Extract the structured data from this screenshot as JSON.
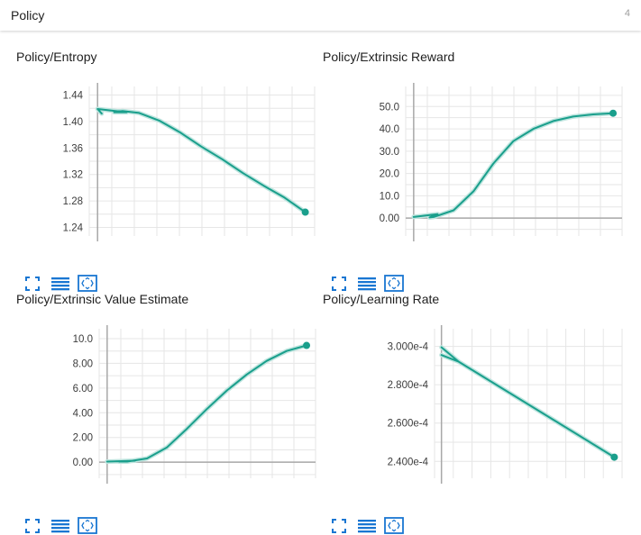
{
  "header": {
    "title": "Policy",
    "count": "4"
  },
  "colors": {
    "line": "#1a9f8c",
    "smooth": "#bfe5df",
    "grid": "#e6e6e6",
    "axis": "#a8a8a8",
    "tool": "#1976d2"
  },
  "icons": [
    "fullscreen-icon",
    "data-table-icon",
    "fit-domain-icon"
  ],
  "chart_data": [
    {
      "type": "line",
      "title": "Policy/Entropy",
      "yticks": [
        "1.44",
        "1.40",
        "1.36",
        "1.32",
        "1.28",
        "1.24"
      ],
      "ytick_values": [
        1.44,
        1.4,
        1.36,
        1.32,
        1.28,
        1.24
      ],
      "ylim": [
        1.227,
        1.453
      ],
      "xlim": [
        -0.04,
        1.045
      ],
      "x": [
        0.02,
        0.0,
        0.14,
        0.08,
        0.12,
        0.2,
        0.3,
        0.4,
        0.5,
        0.6,
        0.7,
        0.8,
        0.9,
        1.0
      ],
      "y": [
        1.412,
        1.419,
        1.414,
        1.414,
        1.416,
        1.413,
        1.401,
        1.383,
        1.362,
        1.343,
        1.322,
        1.303,
        1.285,
        1.263
      ],
      "grid": true,
      "legend": "none"
    },
    {
      "type": "line",
      "title": "Policy/Extrinsic Reward",
      "yticks": [
        "50.0",
        "40.0",
        "30.0",
        "20.0",
        "10.0",
        "0.00"
      ],
      "ytick_values": [
        50,
        40,
        30,
        20,
        10,
        0
      ],
      "ylim": [
        -8,
        59
      ],
      "xlim": [
        -0.04,
        1.045
      ],
      "x": [
        0.0,
        0.12,
        0.08,
        0.1,
        0.2,
        0.3,
        0.4,
        0.5,
        0.6,
        0.7,
        0.8,
        0.9,
        1.0
      ],
      "y": [
        0.5,
        1.8,
        0.3,
        0.5,
        3.5,
        12.0,
        24.5,
        34.5,
        40.0,
        43.5,
        45.5,
        46.5,
        47.0
      ],
      "grid": true,
      "legend": "none"
    },
    {
      "type": "line",
      "title": "Policy/Extrinsic Value Estimate",
      "yticks": [
        "10.0",
        "8.00",
        "6.00",
        "4.00",
        "2.00",
        "0.00"
      ],
      "ytick_values": [
        10,
        8,
        6,
        4,
        2,
        0
      ],
      "ylim": [
        -1.3,
        10.8
      ],
      "xlim": [
        -0.04,
        1.045
      ],
      "x": [
        0.0,
        0.14,
        0.06,
        0.1,
        0.2,
        0.3,
        0.4,
        0.5,
        0.6,
        0.7,
        0.8,
        0.9,
        1.0
      ],
      "y": [
        0.05,
        0.12,
        0.05,
        0.05,
        0.3,
        1.2,
        2.7,
        4.3,
        5.8,
        7.1,
        8.2,
        9.0,
        9.45
      ],
      "grid": true,
      "legend": "none"
    },
    {
      "type": "line",
      "title": "Policy/Learning Rate",
      "yticks": [
        "3.000e-4",
        "2.800e-4",
        "2.600e-4",
        "2.400e-4"
      ],
      "ytick_values": [
        0.0003,
        0.00028,
        0.00026,
        0.00024
      ],
      "ylim": [
        0.0002312,
        0.0003092
      ],
      "xlim": [
        -0.04,
        1.045
      ],
      "x": [
        0.0,
        0.1,
        0.0,
        0.1,
        1.0
      ],
      "y": [
        0.0002995,
        0.000292,
        0.0002955,
        0.000292,
        0.0002422
      ],
      "grid": true,
      "legend": "none"
    }
  ]
}
